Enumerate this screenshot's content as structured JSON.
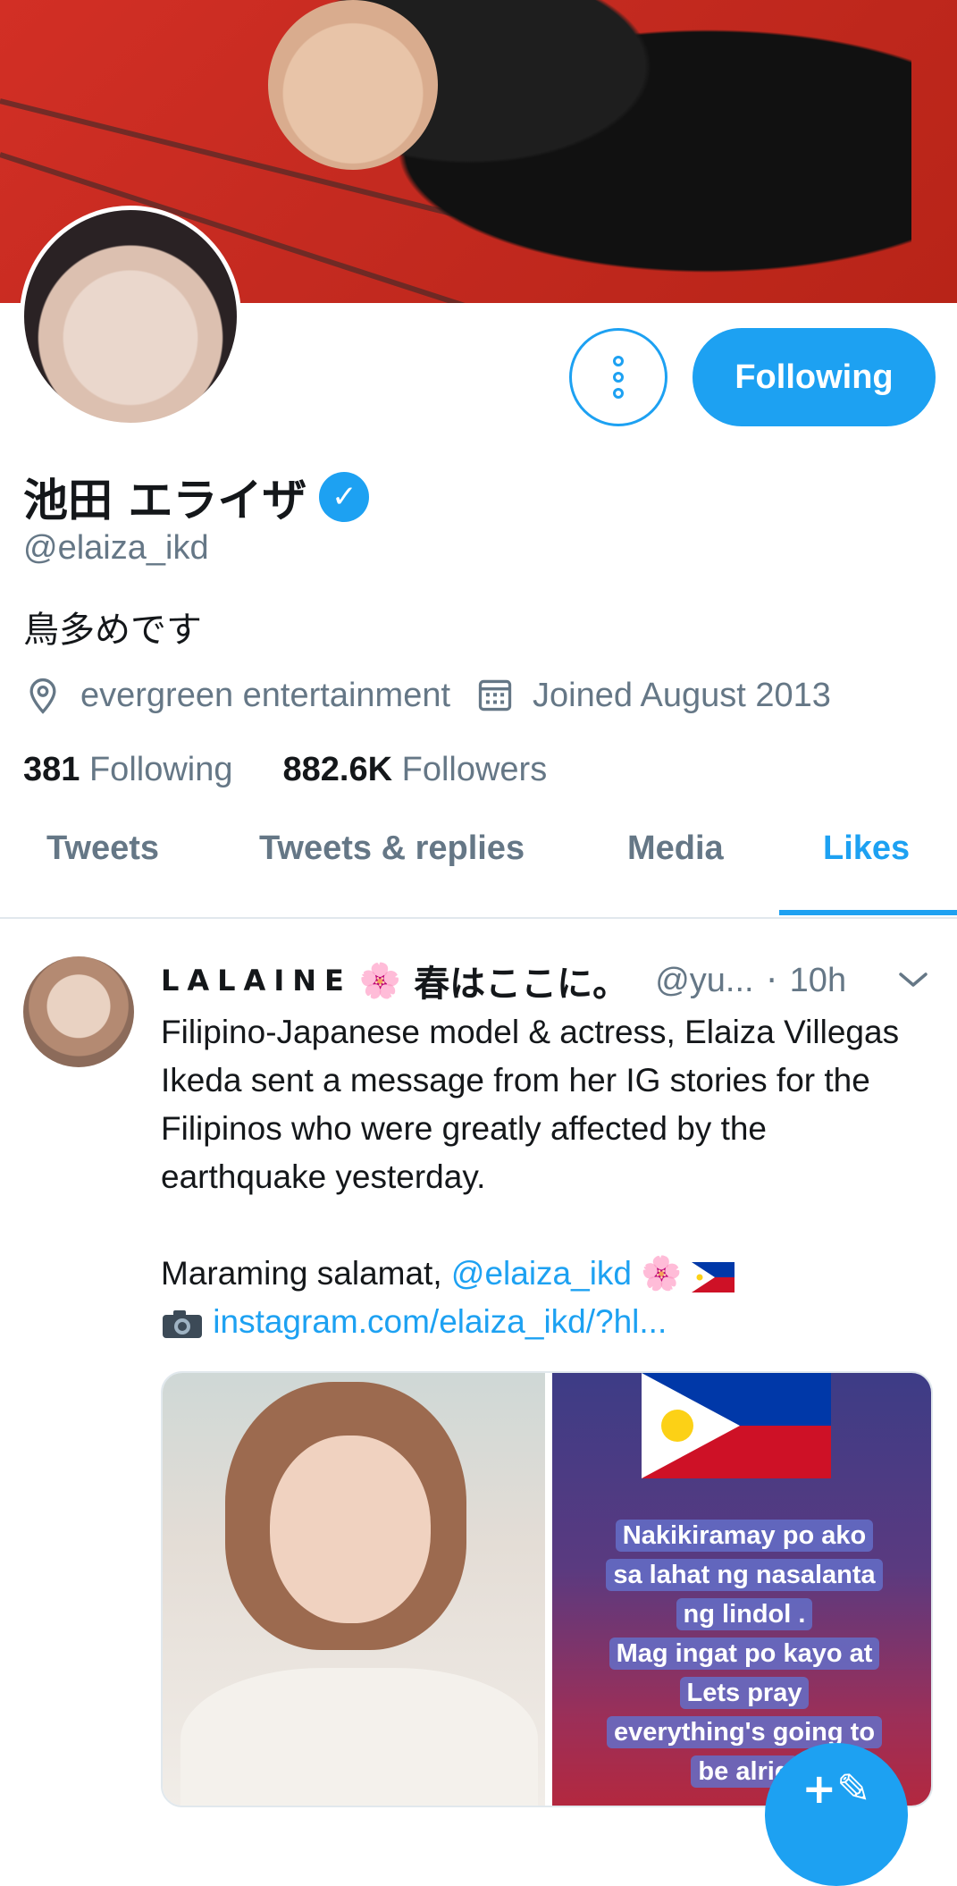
{
  "profile": {
    "display_name": "池田 エライザ",
    "handle": "@elaiza_ikd",
    "bio": "鳥多めです",
    "location": "evergreen entertainment",
    "joined": "Joined August 2013",
    "following_count": "381",
    "following_label": "Following",
    "followers_count": "882.6K",
    "followers_label": "Followers",
    "follow_button": "Following"
  },
  "tabs": [
    "Tweets",
    "Tweets & replies",
    "Media",
    "Likes"
  ],
  "active_tab": "Likes",
  "tweet": {
    "name": "LALAINE",
    "name_suffix": "春はここに。",
    "handle": "@yu...",
    "separator": "·",
    "time": "10h",
    "text_1": "Filipino-Japanese model & actress, Elaiza Villegas Ikeda sent a message from her IG stories for the Filipinos who were greatly affected by the earthquake yesterday.",
    "text_2_prefix": "Maraming salamat, ",
    "mention": "@elaiza_ikd",
    "link": "instagram.com/elaiza_ikd/?hl...",
    "image_text": [
      "Nakikiramay po ako",
      "sa  lahat ng nasalanta",
      "ng lindol .",
      "Mag ingat po kayo at",
      "Lets pray",
      "everything's going to",
      "be alrig"
    ]
  },
  "colors": {
    "accent": "#1da1f2",
    "secondary_text": "#657786",
    "primary_text": "#14171a"
  },
  "icons": {
    "more": "more-vertical-icon",
    "verified": "verified-badge-icon",
    "location": "location-pin-icon",
    "calendar": "calendar-icon",
    "chevron": "chevron-down-icon",
    "compose": "compose-tweet-icon",
    "camera": "camera-icon",
    "flower": "cherry-blossom-icon",
    "flag": "philippines-flag-icon"
  }
}
